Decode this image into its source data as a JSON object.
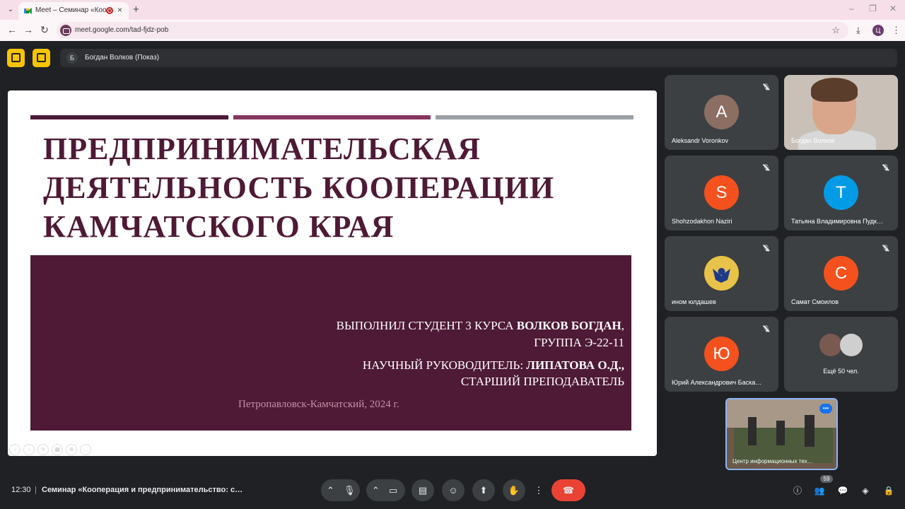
{
  "browser": {
    "tab_menu_icon": "chevron-down-icon",
    "tab_title": "Meet – Семинар «Коопер…",
    "tab_close": "×",
    "new_tab": "+",
    "url": "meet.google.com/tad-fjdz-pob",
    "profile_initial": "Ц",
    "window_controls": [
      "–",
      "❐",
      "✕"
    ]
  },
  "meet": {
    "presenter_avatar": "Б",
    "presenter_name": "Богдан Волков (Показ)"
  },
  "slide": {
    "title_lines": [
      "ПРЕДПРИНИМАТЕЛЬСКАЯ",
      "ДЕЯТЕЛЬНОСТЬ КООПЕРАЦИИ",
      "КАМЧАТСКОГО КРАЯ"
    ],
    "student_prefix": "ВЫПОЛНИЛ СТУДЕНТ 3 КУРСА ",
    "student_name": "ВОЛКОВ БОГДАН",
    "student_suffix": ",",
    "group": "ГРУППА Э-22-11",
    "supervisor_prefix": "НАУЧНЫЙ РУКОВОДИТЕЛЬ: ",
    "supervisor_name": "ЛИПАТОВА О.Д.,",
    "supervisor_title": "СТАРШИЙ ПРЕПОДАВАТЕЛЬ",
    "city_year": "Петропавловск-Камчатский, 2024 г.",
    "colors": {
      "accent": "#4e1a36",
      "stripe2": "#86365e",
      "stripe3": "#9aa0a6"
    }
  },
  "participants": [
    {
      "name": "Aleksandr Voronkov",
      "initial": "A",
      "color": "#8d6e63",
      "muted": true
    },
    {
      "name": "Богдан Волков",
      "initial": "",
      "color": "",
      "muted": false,
      "video": true
    },
    {
      "name": "Shohzodakhon Naziri",
      "initial": "S",
      "color": "#f4511e",
      "muted": true
    },
    {
      "name": "Татьяна Владимировна Пудк…",
      "initial": "T",
      "color": "#039be5",
      "muted": true
    },
    {
      "name": "ином юлдашев",
      "initial": "",
      "color": "#fbc02d",
      "muted": true,
      "emblem": true
    },
    {
      "name": "Самат Смоилов",
      "initial": "C",
      "color": "#f4511e",
      "muted": true
    },
    {
      "name": "Юрий Александрович Баска…",
      "initial": "Ю",
      "color": "#f4511e",
      "muted": true
    },
    {
      "name": "Ещё 50 чел.",
      "initial": "",
      "color": "",
      "muted": false,
      "more": true
    }
  ],
  "self_view": {
    "name": "Центр информационных тех…"
  },
  "bottom_bar": {
    "time": "12:30",
    "separator": "|",
    "meeting_title": "Семинар «Кооперация и предпринимательство: с…",
    "participant_count": "59",
    "controls": [
      "chevron-up-icon",
      "mic-icon",
      "chevron-up-icon",
      "camera-icon",
      "captions-icon",
      "emoji-icon",
      "present-icon",
      "hand-icon",
      "more-icon",
      "end-call-icon"
    ],
    "right_controls": [
      "info-icon",
      "people-icon",
      "chat-icon",
      "activities-icon",
      "lock-icon"
    ]
  }
}
